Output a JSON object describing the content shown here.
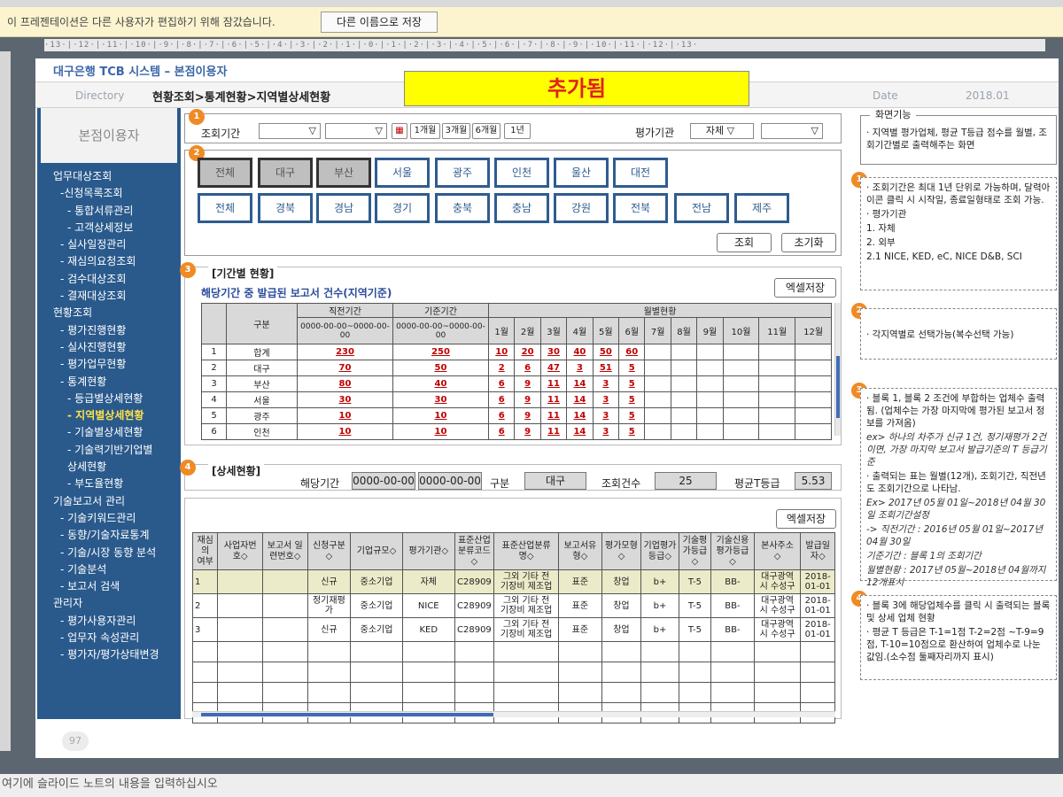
{
  "topbar": {
    "notice": "이 프레젠테이션은 다른 사용자가 편집하기 위해 잠갔습니다.",
    "save_as_button": "다른 이름으로 저장"
  },
  "ruler": "·13·|·12·|·11·|·10·|·9·|·8·|·7·|·6·|·5·|·4·|·3·|·2·|·1·|·0·|·1·|·2·|·3·|·4·|·5·|·6·|·7·|·8·|·9·|·10·|·11·|·12·|·13·",
  "app_title": "대구은행 TCB 시스템 – 본점이용자",
  "header": {
    "directory_label": "Directory",
    "breadcrumb": "현황조회>통계현황>지역별상세현황",
    "added_banner": "추가됨",
    "date_label": "Date",
    "date_value": "2018.01"
  },
  "sidebar": {
    "heading": "본점이용자",
    "items": [
      {
        "label": "업무대상조회",
        "level": 0
      },
      {
        "label": "-신청목록조회",
        "level": 1
      },
      {
        "label": "- 통합서류관리",
        "level": 2
      },
      {
        "label": "- 고객상세정보",
        "level": 2
      },
      {
        "label": "- 실사일정관리",
        "level": 1
      },
      {
        "label": "- 재심의요청조회",
        "level": 1
      },
      {
        "label": "- 검수대상조회",
        "level": 1
      },
      {
        "label": "- 결재대상조회",
        "level": 1
      },
      {
        "label": "현황조회",
        "level": 0
      },
      {
        "label": "- 평가진행현황",
        "level": 1
      },
      {
        "label": "- 실사진행현황",
        "level": 1
      },
      {
        "label": "- 평가업무현황",
        "level": 1
      },
      {
        "label": "- 통계현황",
        "level": 1
      },
      {
        "label": "- 등급별상세현황",
        "level": 2
      },
      {
        "label": "- 지역별상세현황",
        "level": 2,
        "active": true
      },
      {
        "label": "- 기술별상세현황",
        "level": 2
      },
      {
        "label": "- 기술력기반기업별",
        "level": 2
      },
      {
        "label": "  상세현황",
        "level": 2
      },
      {
        "label": "- 부도율현황",
        "level": 2
      },
      {
        "label": "기술보고서 관리",
        "level": 0
      },
      {
        "label": "- 기술키워드관리",
        "level": 1
      },
      {
        "label": "- 동향/기술자료통계",
        "level": 1
      },
      {
        "label": "- 기술/시장 동향 분석",
        "level": 1
      },
      {
        "label": "- 기술분석",
        "level": 1
      },
      {
        "label": "- 보고서 검색",
        "level": 1
      },
      {
        "label": "관리자",
        "level": 0
      },
      {
        "label": "- 평가사용자관리",
        "level": 1
      },
      {
        "label": "- 업무자 속성관리",
        "level": 1
      },
      {
        "label": "- 평가자/평가상태변경",
        "level": 1
      }
    ]
  },
  "block1": {
    "badge": "1",
    "period_label": "조회기간",
    "dd_arrow": "▽",
    "btn_1m": "1개월",
    "btn_3m": "3개월",
    "btn_6m": "6개월",
    "btn_1y": "1년",
    "agency_label": "평가기관",
    "agency_value": "자체",
    "agency_value2": ""
  },
  "block2": {
    "badge": "2",
    "regions_row1": [
      {
        "label": "전체",
        "sel": true
      },
      {
        "label": "대구",
        "sel": true
      },
      {
        "label": "부산",
        "sel": true
      },
      {
        "label": "서울",
        "sel": false
      },
      {
        "label": "광주",
        "sel": false
      },
      {
        "label": "인천",
        "sel": false
      },
      {
        "label": "울산",
        "sel": false
      },
      {
        "label": "대전",
        "sel": false
      }
    ],
    "regions_row2": [
      "전체",
      "경북",
      "경남",
      "경기",
      "충북",
      "충남",
      "강원",
      "전북",
      "전남",
      "제주"
    ],
    "search_button": "조회",
    "reset_button": "초기화"
  },
  "block3": {
    "badge": "3",
    "title": "[기간별 현황]",
    "subtitle": "해당기간 중 발급된 보고서 건수(지역기준)",
    "excel_button": "엑셀저장",
    "headers": {
      "category": "구분",
      "prev": "직전기간",
      "base": "기준기간",
      "monthly": "월별현황",
      "range": "0000-00-00~0000-00-00",
      "months": [
        "1월",
        "2월",
        "3월",
        "4월",
        "5월",
        "6월",
        "7월",
        "8월",
        "9월",
        "10월",
        "11월",
        "12월"
      ]
    },
    "rows": [
      {
        "no": "1",
        "name": "합계",
        "prev": "230",
        "base": "250",
        "m": [
          "10",
          "20",
          "30",
          "40",
          "50",
          "60"
        ]
      },
      {
        "no": "2",
        "name": "대구",
        "prev": "70",
        "base": "50",
        "m": [
          "2",
          "6",
          "47",
          "3",
          "51",
          "5"
        ]
      },
      {
        "no": "3",
        "name": "부산",
        "prev": "80",
        "base": "40",
        "m": [
          "6",
          "9",
          "11",
          "14",
          "3",
          "5"
        ]
      },
      {
        "no": "4",
        "name": "서울",
        "prev": "30",
        "base": "30",
        "m": [
          "6",
          "9",
          "11",
          "14",
          "3",
          "5"
        ]
      },
      {
        "no": "5",
        "name": "광주",
        "prev": "10",
        "base": "10",
        "m": [
          "6",
          "9",
          "11",
          "14",
          "3",
          "5"
        ]
      },
      {
        "no": "6",
        "name": "인천",
        "prev": "10",
        "base": "10",
        "m": [
          "6",
          "9",
          "11",
          "14",
          "3",
          "5"
        ]
      }
    ]
  },
  "block4": {
    "badge": "4",
    "title": "[상세현황]",
    "period_label": "해당기간",
    "date_from": "0000-00-00",
    "date_to": "0000-00-00",
    "category_label": "구분",
    "category_value": "대구",
    "count_label": "조회건수",
    "count_value": "25",
    "avg_label": "평균T등급",
    "avg_value": "5.53",
    "excel_button": "엑셀저장",
    "headers": [
      "재심의\n여부",
      "사업자번\n호◇",
      "보고서 일\n련번호◇",
      "신청구분\n◇",
      "기업규모◇",
      "평가기관◇",
      "표준산업\n분류코드\n◇",
      "표준산업분류\n명◇",
      "보고서유\n형◇",
      "평가모형\n◇",
      "기업평가\n등급◇",
      "기술평\n가등급\n◇",
      "기술신용\n평가등급\n◇",
      "본사주소\n◇",
      "발급일\n자◇"
    ],
    "rows": [
      [
        "1",
        "",
        "",
        "신규",
        "중소기업",
        "자체",
        "C28909",
        "그외 기타 전\n기장비 제조업",
        "표준",
        "창업",
        "b+",
        "T-5",
        "BB-",
        "대구광역\n시 수성구",
        "2018-\n01-01"
      ],
      [
        "2",
        "",
        "",
        "정기재평\n가",
        "중소기업",
        "NICE",
        "C28909",
        "그외 기타 전\n기장비 제조업",
        "표준",
        "창업",
        "b+",
        "T-5",
        "BB-",
        "대구광역\n시 수성구",
        "2018-\n01-01"
      ],
      [
        "3",
        "",
        "",
        "신규",
        "중소기업",
        "KED",
        "C28909",
        "그외 기타 전\n기장비 제조업",
        "표준",
        "창업",
        "b+",
        "T-5",
        "BB-",
        "대구광역\n시 수성구",
        "2018-\n01-01"
      ]
    ]
  },
  "notes": {
    "heading": "화면기능",
    "intro": "· 지역별 평가업체, 평균 T등급 점수를 월별, 조회기간별로 출력해주는 화면",
    "n1": [
      "· 조회기간은 최대 1년 단위로 가능하며, 달력아이콘 클릭 시 시작일, 종료일형태로 조회 가능.",
      "· 평가기관",
      "1. 자체",
      "2. 외부",
      "2.1 NICE, KED, eC, NICE D&B, SCI"
    ],
    "n2": [
      "· 각지역별로 선택가능(복수선택 가능)"
    ],
    "n3": [
      "· 블록 1, 블록 2 조건에 부합하는 업체수 출력됨. (업체수는 가장 마지막에 평가된 보고서 정보를 가져옴)",
      "ex> 하나의 차주가 신규 1건, 정기재평가 2건이면, 가장 마지막 보고서 발급기준의 T 등급기준",
      "· 출력되는 표는 월별(12개), 조회기간, 직전년도 조회기간으로 나타남.",
      "Ex> 2017년 05월 01일~2018년 04월 30일 조회기간설정",
      "-> 직전기간 : 2016년 05월 01일~2017년 04월 30일",
      "기준기간 : 블록 1의 조회기간",
      "월별현황 : 2017년 05월~2018년 04월까지 12개표시"
    ],
    "n4": [
      "· 블록 3에 해당업체수를 클릭 시 출력되는 블록 및 상세 업체 현황",
      "· 평균 T 등급은 T-1=1점 T-2=2점 ~T-9=9점, T-10=10점으로 환산하여 업체수로 나눈 값임.(소수점 둘째자리까지 표시)"
    ],
    "badges": [
      "1",
      "2",
      "3",
      "4"
    ]
  },
  "page_number": "97",
  "bottom_note": "여기에 슬라이드 노트의 내용을 입력하십시오"
}
